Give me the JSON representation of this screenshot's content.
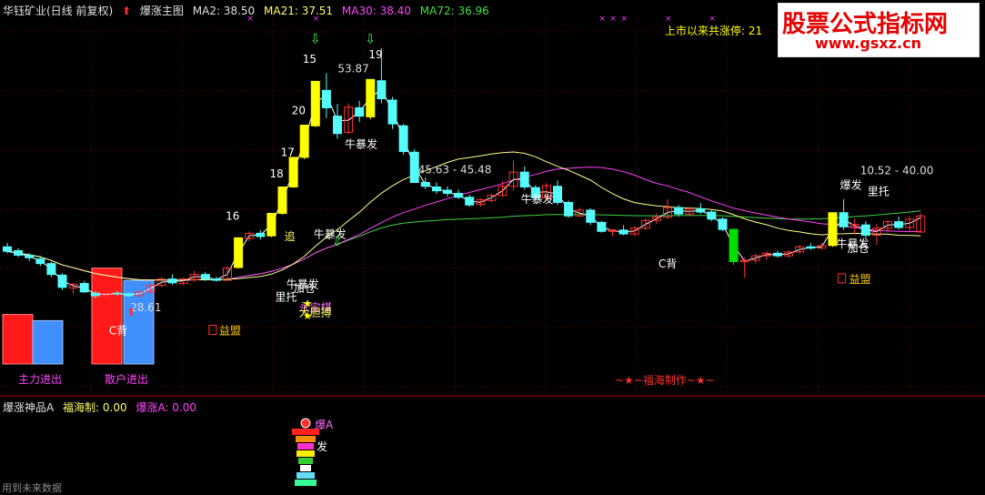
{
  "header": {
    "stock_name": "华钰矿业(日线 前复权)",
    "indicator_name": "爆涨主图",
    "ma2": "MA2: 38.50",
    "ma21": "MA21: 37.51",
    "ma30": "MA30: 38.40",
    "ma72": "MA72: 36.96"
  },
  "lower_header": {
    "title": "爆涨神品A",
    "fuhai": "福海制: 0.00",
    "baozhang": "爆涨A: 0.00"
  },
  "limit_up_info": "上市以来共涨停:    21",
  "watermark": {
    "line1": "股票公式指标网",
    "line2": "www.gsxz.cn"
  },
  "footer_note": "用到未来数据",
  "credit": "~★~福海制作~★~",
  "colors": {
    "up": "#ff3232",
    "down": "#54fcfc",
    "limit": "#ffff00",
    "drop": "#00e000",
    "ma_yellow": "#ffff88",
    "ma_magenta": "#ff40ff",
    "ma_green": "#40d040"
  },
  "chart_data": {
    "type": "candlestick",
    "ylim": [
      18,
      72
    ],
    "price_labels": [
      "53.87",
      "45.63 - 45.48",
      "28.61",
      "10.52 - 40.00"
    ],
    "count_labels": [
      "15",
      "19",
      "20",
      "17",
      "18",
      "16"
    ],
    "signal_labels": [
      "牛暴发",
      "追",
      "牛暴发",
      "牛暴发",
      "牛暴发",
      "牛暴发",
      "加仓",
      "里托",
      "永宝棋",
      "大胆搏",
      "C背",
      "C背",
      "益盟",
      "益盟",
      "加仓",
      "爆发",
      "里托"
    ],
    "side_bars": [
      {
        "label": "主力进出",
        "values": [
          32,
          28
        ]
      },
      {
        "label": "散户进出",
        "values": [
          62,
          54
        ]
      }
    ],
    "candles": [
      [
        36.2,
        36.8,
        35.2,
        35.5
      ],
      [
        35.6,
        36.0,
        34.6,
        34.9
      ],
      [
        34.9,
        35.2,
        34.0,
        34.5
      ],
      [
        34.3,
        34.8,
        33.2,
        33.6
      ],
      [
        33.6,
        33.9,
        31.5,
        31.9
      ],
      [
        31.8,
        32.1,
        29.5,
        29.9
      ],
      [
        29.8,
        30.6,
        28.9,
        30.4
      ],
      [
        30.5,
        30.9,
        29.0,
        29.2
      ],
      [
        29.0,
        29.3,
        28.2,
        28.6
      ],
      [
        28.6,
        29.2,
        28.2,
        29.0
      ],
      [
        29.0,
        29.4,
        28.6,
        28.9
      ],
      [
        28.9,
        29.1,
        28.4,
        28.6
      ],
      [
        28.6,
        29.3,
        28.4,
        29.2
      ],
      [
        29.2,
        30.4,
        29.0,
        30.2
      ],
      [
        30.2,
        31.5,
        29.9,
        31.2
      ],
      [
        31.2,
        31.9,
        30.3,
        30.6
      ],
      [
        30.5,
        31.4,
        30.2,
        31.2
      ],
      [
        31.1,
        32.5,
        30.7,
        31.9
      ],
      [
        31.9,
        32.3,
        30.9,
        31.2
      ],
      [
        31.2,
        31.6,
        30.8,
        31.0
      ],
      [
        31.0,
        33.2,
        30.9,
        32.9
      ],
      [
        33.0,
        37.6,
        32.8,
        37.6
      ],
      [
        37.5,
        38.6,
        37.1,
        38.3
      ],
      [
        38.3,
        38.8,
        37.3,
        37.8
      ],
      [
        37.9,
        41.4,
        37.7,
        41.4
      ],
      [
        41.4,
        45.5,
        41.2,
        45.5
      ],
      [
        45.5,
        50.1,
        45.4,
        50.1
      ],
      [
        50.1,
        55.1,
        49.8,
        55.1
      ],
      [
        55.0,
        62.0,
        54.8,
        61.9
      ],
      [
        60.5,
        63.2,
        56.2,
        57.8
      ],
      [
        56.5,
        58.4,
        53.0,
        53.8
      ],
      [
        54.0,
        58.5,
        53.7,
        57.9
      ],
      [
        57.8,
        58.9,
        55.6,
        56.5
      ],
      [
        56.4,
        62.2,
        56.0,
        62.2
      ],
      [
        62.0,
        67.1,
        58.5,
        59.2
      ],
      [
        59.0,
        59.5,
        54.5,
        55.3
      ],
      [
        55.0,
        55.3,
        50.5,
        51.0
      ],
      [
        50.9,
        51.4,
        46.1,
        46.2
      ],
      [
        46.2,
        47.0,
        45.2,
        45.6
      ],
      [
        45.5,
        46.2,
        44.4,
        44.9
      ],
      [
        45.0,
        45.6,
        44.0,
        44.5
      ],
      [
        44.5,
        45.1,
        43.6,
        43.9
      ],
      [
        43.9,
        44.3,
        42.4,
        42.7
      ],
      [
        42.8,
        43.8,
        42.4,
        43.5
      ],
      [
        43.4,
        44.5,
        43.1,
        44.2
      ],
      [
        44.2,
        46.4,
        43.9,
        45.6
      ],
      [
        45.6,
        49.6,
        45.0,
        47.8
      ],
      [
        47.8,
        48.7,
        45.1,
        45.5
      ],
      [
        45.4,
        45.8,
        43.6,
        43.8
      ],
      [
        43.8,
        46.1,
        43.5,
        45.7
      ],
      [
        45.6,
        46.5,
        42.7,
        43.1
      ],
      [
        43.1,
        43.4,
        40.7,
        41.0
      ],
      [
        41.0,
        42.3,
        40.8,
        41.9
      ],
      [
        41.9,
        42.2,
        39.6,
        40.0
      ],
      [
        40.0,
        40.2,
        38.4,
        38.6
      ],
      [
        38.6,
        39.0,
        37.8,
        38.8
      ],
      [
        38.8,
        39.6,
        38.0,
        38.2
      ],
      [
        38.2,
        39.4,
        37.9,
        39.1
      ],
      [
        39.1,
        40.6,
        38.8,
        40.3
      ],
      [
        40.3,
        41.4,
        39.8,
        40.8
      ],
      [
        40.8,
        43.6,
        40.5,
        42.3
      ],
      [
        42.3,
        42.7,
        40.9,
        41.3
      ],
      [
        41.3,
        42.4,
        40.9,
        42.1
      ],
      [
        42.1,
        43.0,
        41.3,
        41.6
      ],
      [
        41.6,
        41.9,
        40.2,
        40.5
      ],
      [
        40.5,
        40.8,
        38.6,
        38.9
      ],
      [
        38.9,
        39.1,
        33.4,
        33.9
      ],
      [
        33.9,
        34.6,
        31.4,
        34.1
      ],
      [
        34.1,
        35.1,
        33.6,
        34.8
      ],
      [
        34.8,
        35.5,
        34.2,
        35.2
      ],
      [
        35.2,
        35.6,
        34.5,
        34.8
      ],
      [
        34.8,
        35.7,
        34.5,
        35.4
      ],
      [
        35.4,
        36.5,
        35.1,
        36.2
      ],
      [
        36.2,
        36.8,
        35.7,
        36.0
      ],
      [
        36.0,
        36.8,
        35.8,
        36.4
      ],
      [
        36.4,
        41.5,
        36.2,
        41.5
      ],
      [
        41.5,
        43.6,
        38.8,
        39.3
      ],
      [
        39.3,
        40.6,
        38.1,
        39.7
      ],
      [
        39.6,
        40.2,
        37.4,
        38.0
      ],
      [
        38.0,
        39.8,
        36.5,
        39.1
      ],
      [
        39.1,
        40.3,
        38.4,
        40.1
      ],
      [
        40.1,
        40.9,
        38.9,
        39.2
      ],
      [
        39.2,
        41.0,
        38.6,
        40.5
      ],
      [
        38.5,
        41.4,
        38.4,
        41.0
      ]
    ]
  }
}
